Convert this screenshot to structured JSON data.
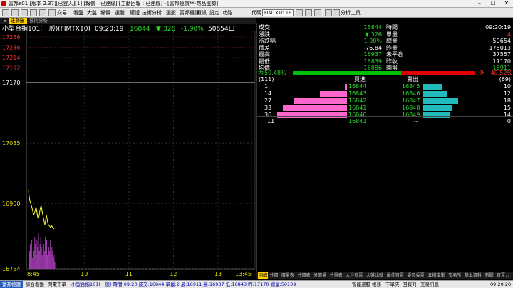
{
  "window": {
    "title": "富邦e01 [版本 2.37][已登入][1] [報價 : 已連線] [主動回報 : 已連線] - [富邦極讚**-商品盤勢]"
  },
  "menubar": {
    "items": [
      "交易",
      "看盤",
      "大盤",
      "報價",
      "選股",
      "權證",
      "技術分析",
      "選股",
      "富邦極讚",
      "資訊",
      "設定",
      "功能"
    ],
    "quote_label": "代碼",
    "quote_value": "FIMTX10.TF",
    "tool_label": "分析工具"
  },
  "tabs": {
    "active": "走勢圖",
    "second": "技術分析"
  },
  "header": {
    "product": "小型台指101(一般)(FIMTX10)",
    "time": "09:20:19",
    "price": "16844",
    "arrow": "▼",
    "change": "326",
    "pct": "-1.90%",
    "volume": "50654口"
  },
  "chart_data": {
    "type": "line",
    "ylim": [
      16754,
      17256
    ],
    "reference": 17170,
    "y_labels_top": [
      "17256",
      "17236",
      "17214",
      "17192"
    ],
    "y_labels_main": [
      "17170",
      "17035",
      "16900",
      "16754"
    ],
    "x_ticks": [
      "8:45",
      "10",
      "11",
      "12",
      "13",
      "13:45"
    ],
    "session_minutes": 300,
    "price_series": [
      [
        0,
        16930
      ],
      [
        1,
        16915
      ],
      [
        2,
        16905
      ],
      [
        3,
        16900
      ],
      [
        4,
        16895
      ],
      [
        5,
        16888
      ],
      [
        6,
        16880
      ],
      [
        7,
        16875
      ],
      [
        8,
        16878
      ],
      [
        9,
        16884
      ],
      [
        10,
        16892
      ],
      [
        11,
        16885
      ],
      [
        12,
        16872
      ],
      [
        13,
        16866
      ],
      [
        14,
        16870
      ],
      [
        15,
        16880
      ],
      [
        16,
        16890
      ],
      [
        17,
        16895
      ],
      [
        18,
        16886
      ],
      [
        19,
        16876
      ],
      [
        20,
        16868
      ],
      [
        21,
        16860
      ],
      [
        22,
        16852
      ],
      [
        23,
        16862
      ],
      [
        24,
        16874
      ],
      [
        25,
        16866
      ],
      [
        26,
        16856
      ],
      [
        27,
        16852
      ],
      [
        28,
        16850
      ],
      [
        29,
        16848
      ],
      [
        30,
        16846
      ],
      [
        31,
        16850
      ],
      [
        32,
        16848
      ],
      [
        33,
        16845
      ],
      [
        34,
        16844
      ],
      [
        35,
        16845
      ]
    ],
    "volume_series": [
      9,
      5,
      7,
      4,
      8,
      3,
      6,
      5,
      9,
      7,
      4,
      8,
      6,
      10,
      5,
      7,
      9,
      6,
      4,
      8,
      7,
      5,
      9,
      6,
      8,
      4,
      7,
      6,
      5,
      8,
      4,
      6,
      5,
      3,
      4,
      2
    ],
    "volume_max": 10
  },
  "summary": {
    "rows": [
      {
        "l1": "成交",
        "v1": "16844",
        "c1": "green",
        "l2": "時間",
        "v2": "09:20:19",
        "c2": "white"
      },
      {
        "l1": "漲跌",
        "v1": "▼ 326",
        "c1": "green",
        "l2": "單量",
        "v2": "4",
        "c2": "red"
      },
      {
        "l1": "漲跌幅",
        "v1": "-1.90%",
        "c1": "green",
        "l2": "總量",
        "v2": "50654",
        "c2": "white"
      },
      {
        "l1": "價差",
        "v1": "-76.84",
        "c1": "white",
        "l2": "昨量",
        "v2": "175013",
        "c2": "white"
      },
      {
        "l1": "最高",
        "v1": "16937",
        "c1": "green",
        "l2": "未平倉",
        "v2": "37557",
        "c2": "white"
      },
      {
        "l1": "最低",
        "v1": "16839",
        "c1": "green",
        "l2": "昨收",
        "v2": "17170",
        "c2": "white"
      },
      {
        "l1": "均價",
        "v1": "16886",
        "c1": "green",
        "l2": "開盤",
        "v2": "16911",
        "c2": "green"
      }
    ]
  },
  "ratio": {
    "inner_label": "內",
    "inner": "59.48%",
    "outer_label": "外",
    "outer": "40.52%",
    "inner_fraction": 0.5948,
    "inner_color": "#00c000",
    "outer_color": "#e00000"
  },
  "orderbook": {
    "bid_total": "(111)",
    "ask_total": "(69)",
    "bid_header": "買進",
    "ask_header": "賣出",
    "bid_color": "#ff66cc",
    "ask_color": "#22bbbb",
    "max_qty": 36,
    "rows": [
      {
        "bid_qty": "1",
        "bid_price": "16844",
        "ask_price": "16845",
        "ask_qty": "10",
        "bq": 1,
        "aq": 10
      },
      {
        "bid_qty": "14",
        "bid_price": "16843",
        "ask_price": "16846",
        "ask_qty": "12",
        "bq": 14,
        "aq": 12
      },
      {
        "bid_qty": "27",
        "bid_price": "16842",
        "ask_price": "16847",
        "ask_qty": "18",
        "bq": 27,
        "aq": 18
      },
      {
        "bid_qty": "33",
        "bid_price": "16841",
        "ask_price": "16848",
        "ask_qty": "15",
        "bq": 33,
        "aq": 15
      },
      {
        "bid_qty": "36",
        "bid_price": "16840",
        "ask_price": "16849",
        "ask_qty": "14",
        "bq": 36,
        "aq": 14
      }
    ],
    "last": {
      "left": "11",
      "price": "16841",
      "mid": "--",
      "right": "0"
    }
  },
  "bottom_tabs": [
    "明細",
    "分價",
    "價量表",
    "分價表",
    "分價量",
    "分量表",
    "大戶買賣",
    "大盤比較",
    "最佳買賣",
    "委買委賣",
    "五檔掛單",
    "交易所",
    "基本資料",
    "新聞",
    "買賣力",
    "閃電委買賣"
  ],
  "statusbar": {
    "left1": "富邦極讚",
    "left2": "綜合看盤",
    "left3": "閃電下單",
    "ticker": "小型台指101(一般) 時間:09:20 成交:16844 單量:2 最:16911 高:16937 低:16843 昨:17170 總量:50109",
    "right": [
      "智能選股",
      "帳務",
      "下單夾",
      "回報列",
      "交易訊息"
    ],
    "time": "09:20:20"
  }
}
